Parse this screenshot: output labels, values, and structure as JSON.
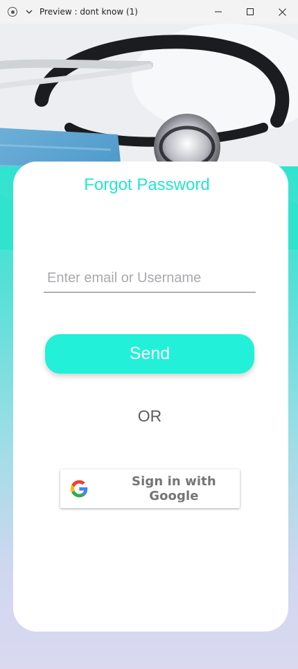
{
  "window": {
    "title": "Preview : dont know (1)",
    "controls": [
      "minimize",
      "maximize",
      "close"
    ]
  },
  "card": {
    "title": "Forgot Password",
    "email_placeholder": "Enter email or Username",
    "email_value": "",
    "send_label": "Send",
    "or_label": "OR",
    "google_label": "Sign in with Google"
  },
  "colors": {
    "accent": "#22e5d2",
    "button": "#22f0d8",
    "gradient_top": "#2fe3cf",
    "gradient_bottom": "#dad9f0"
  },
  "icons": {
    "app": "app-record-icon",
    "chevron": "chevron-down-icon",
    "minimize": "minimize-icon",
    "maximize": "maximize-icon",
    "close": "close-icon",
    "google": "google-g-icon"
  }
}
